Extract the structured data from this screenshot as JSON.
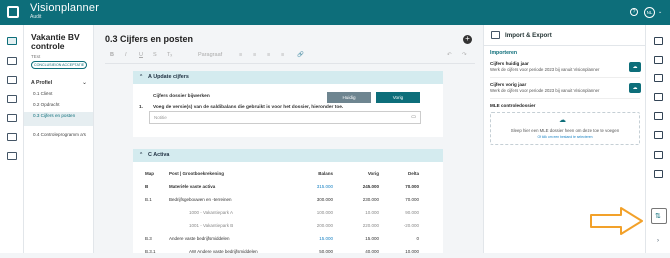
{
  "header": {
    "app_title": "Visionplanner",
    "app_subtitle": "Audit",
    "help": "?",
    "avatar": "NL",
    "caret": "⌄"
  },
  "nav": {
    "title": "Vakantie BV controle",
    "subtitle": "TEst",
    "badge": "CONCLUSIE/ON ACCEPTATIE",
    "section": "A Profiel",
    "items": [
      {
        "label": "0.1 Cliënt"
      },
      {
        "label": "0.2 Opdracht"
      },
      {
        "label": "0.3 Cijfers en posten"
      },
      {
        "label": "0.4 Controleprogramm a's"
      }
    ]
  },
  "main": {
    "page_title": "0.3 Cijfers en posten",
    "add_button": "+",
    "toolbar": {
      "bold": "B",
      "italic": "I",
      "underline": "U",
      "strike": "S",
      "clear": "Tₓ",
      "paragraph": "Paragraaf",
      "align": "≡",
      "link": "🔗",
      "undo": "↶",
      "redo": "↷"
    },
    "section_a": {
      "title": "A   Update cijfers",
      "chev": "⌃",
      "cijfers_label": "Cijfers dossier bijwerken",
      "huidig": "Huidig",
      "vorig": "Vorig",
      "step_num": "1.",
      "step_text": "Voeg de versie(s) van de saldibalans die gebruikt is voor het dossier, hieronder toe.",
      "note_placeholder": "Notitie"
    },
    "section_c": {
      "title": "C   Activa",
      "chev": "⌃",
      "columns": {
        "map": "Map",
        "post": "Post | Grootboekrekening",
        "balans": "Balans",
        "vorig": "Vorig",
        "delta": "Delta"
      },
      "rows": [
        {
          "map": "B",
          "post": "Materiële vaste activa",
          "balans": "315.000",
          "vorig": "245.000",
          "delta": "70.000"
        },
        {
          "map": "B.1",
          "post": "Bedrijfsgebouwen en -terreinen",
          "balans": "300.000",
          "vorig": "230.000",
          "delta": "70.000"
        },
        {
          "map": "",
          "post": "1000 - Vakantiepark A",
          "balans": "100.000",
          "vorig": "10.000",
          "delta": "90.000"
        },
        {
          "map": "",
          "post": "1001 - Vakantiepark B",
          "balans": "200.000",
          "vorig": "220.000",
          "delta": "-20.000"
        },
        {
          "map": "B.3",
          "post": "Andere vaste bedrijfsmiddelen",
          "balans": "15.000",
          "vorig": "15.000",
          "delta": "0"
        },
        {
          "map": "B.3.1",
          "post": "AW Andere vaste bedrijfsmiddelen",
          "balans": "50.000",
          "vorig": "40.000",
          "delta": "10.000"
        }
      ]
    }
  },
  "right_panel": {
    "title": "Import & Export",
    "section": "Importeren",
    "items": [
      {
        "title": "Cijfers huidig jaar",
        "desc": "Werk de cijfers voor periode 2023 bij vanuit Visionplanner"
      },
      {
        "title": "Cijfers vorig jaar",
        "desc": "Werk de cijfers voor periode 2023 bij vanuit Visionplanner"
      }
    ],
    "mle_title": "MLE controledossier",
    "drop_text": "Sleep hier een MLE dossier heen om deze toe te voegen",
    "drop_sub": "Of klik om een bestand te selecteren"
  },
  "colors": {
    "brand": "#0d6e7a",
    "arrow": "#f2a12a",
    "section_head": "#d4ebef"
  }
}
